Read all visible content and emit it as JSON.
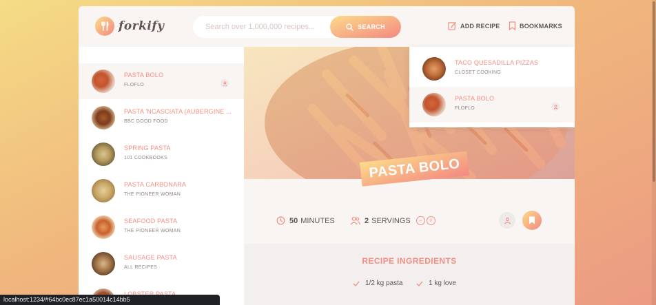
{
  "brand": {
    "name": "forkify",
    "logo_icon": "fork-knife-icon",
    "accent_from": "#fbdb89",
    "accent_to": "#f48982"
  },
  "search": {
    "placeholder": "Search over 1,000,000 recipes...",
    "value": "",
    "button_label": "SEARCH"
  },
  "nav": {
    "add_recipe": "ADD RECIPE",
    "bookmarks": "BOOKMARKS"
  },
  "results": [
    {
      "title": "PASTA BOLO",
      "publisher": "FLOFLO",
      "user_generated": true,
      "active": true
    },
    {
      "title": "PASTA 'NCASCIATA (AUBERGINE ...",
      "publisher": "BBC GOOD FOOD"
    },
    {
      "title": "SPRING PASTA",
      "publisher": "101 COOKBOOKS"
    },
    {
      "title": "PASTA CARBONARA",
      "publisher": "THE PIONEER WOMAN"
    },
    {
      "title": "SEAFOOD PASTA",
      "publisher": "THE PIONEER WOMAN"
    },
    {
      "title": "SAUSAGE PASTA",
      "publisher": "ALL RECIPES"
    },
    {
      "title": "LOBSTER PASTA",
      "publisher": ""
    }
  ],
  "recipe": {
    "title": "PASTA BOLO",
    "cooking_time": "50",
    "minutes_label": "MINUTES",
    "servings": "2",
    "servings_label": "SERVINGS",
    "ingredients_heading": "RECIPE INGREDIENTS",
    "ingredients": [
      "1/2 kg pasta",
      "1 kg love"
    ]
  },
  "bookmarks": [
    {
      "title": "TACO QUESADILLA PIZZAS",
      "publisher": "CLOSET COOKING",
      "user_generated": false
    },
    {
      "title": "PASTA BOLO",
      "publisher": "FLOFLO",
      "user_generated": true,
      "active": true
    }
  ],
  "status_bar": {
    "url": "localhost:1234/#64bc0ec87ec1a50014c14bb5"
  }
}
